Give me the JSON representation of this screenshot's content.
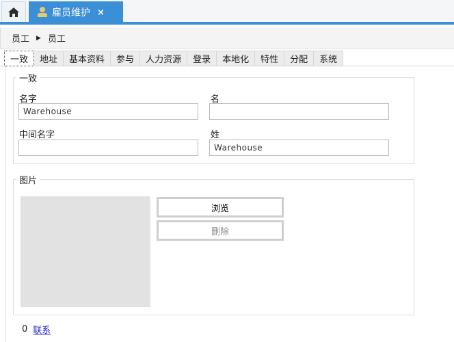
{
  "window_tabs": {
    "home_icon": "home-icon",
    "active_tab": {
      "icon": "user-icon",
      "label": "雇员维护",
      "close_label": "×"
    }
  },
  "breadcrumb": {
    "items": [
      "员工",
      "员工"
    ],
    "separator": "▶"
  },
  "tabs": [
    {
      "label": "一致",
      "active": true
    },
    {
      "label": "地址",
      "active": false
    },
    {
      "label": "基本资料",
      "active": false
    },
    {
      "label": "参与",
      "active": false
    },
    {
      "label": "人力资源",
      "active": false
    },
    {
      "label": "登录",
      "active": false
    },
    {
      "label": "本地化",
      "active": false
    },
    {
      "label": "特性",
      "active": false
    },
    {
      "label": "分配",
      "active": false
    },
    {
      "label": "系统",
      "active": false
    }
  ],
  "general_group": {
    "legend": "一致",
    "fields": {
      "first_name": {
        "label": "名字",
        "value": "Warehouse"
      },
      "given_name": {
        "label": "名",
        "value": ""
      },
      "middle_name": {
        "label": "中间名字",
        "value": ""
      },
      "last_name": {
        "label": "姓",
        "value": "Warehouse"
      }
    }
  },
  "picture_group": {
    "legend": "图片",
    "browse_label": "浏览",
    "delete_label": "删除"
  },
  "footer": {
    "count": "0",
    "link_label": "联系"
  },
  "colors": {
    "accent": "#3a8fd6",
    "link": "#1a1acc",
    "photo_placeholder": "#e2e2e2"
  }
}
